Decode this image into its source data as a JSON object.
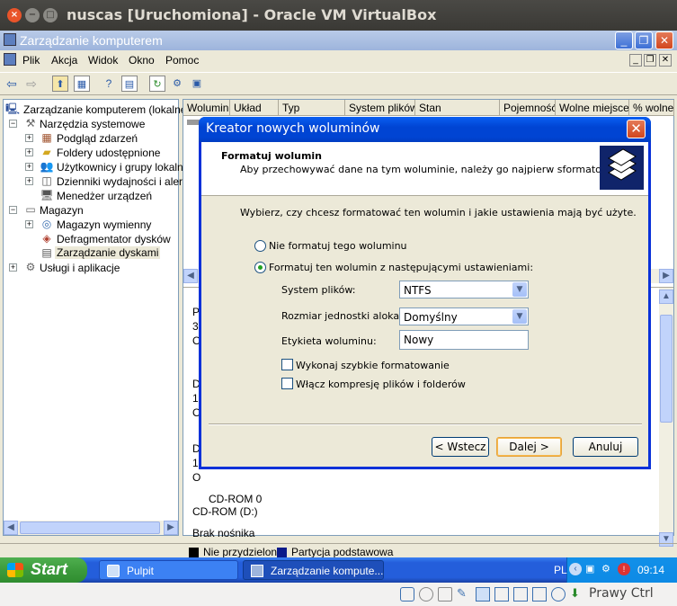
{
  "vbox": {
    "title": "nuscas [Uruchomiona] - Oracle VM VirtualBox",
    "host_key": "Prawy Ctrl"
  },
  "cm": {
    "title": "Zarządzanie komputerem",
    "menu": [
      "Plik",
      "Akcja",
      "Widok",
      "Okno",
      "Pomoc"
    ]
  },
  "tree": {
    "items": [
      "Zarządzanie komputerem (lokalne)",
      "Narzędzia systemowe",
      "Podgląd zdarzeń",
      "Foldery udostępnione",
      "Użytkownicy i grupy lokalne",
      "Dzienniki wydajności i alerty",
      "Menedżer urządzeń",
      "Magazyn",
      "Magazyn wymienny",
      "Defragmentator dysków",
      "Zarządzanie dyskami",
      "Usługi i aplikacje"
    ]
  },
  "volumes": {
    "columns": [
      "Wolumin",
      "Układ",
      "Typ",
      "System plików",
      "Stan",
      "Pojemność",
      "Wolne miejsce",
      "% wolneg"
    ]
  },
  "disks": {
    "cdrom_label": "CD-ROM 0",
    "cdrom_device": "CD-ROM (D:)",
    "cdrom_status": "Brak nośnika",
    "partial": [
      "D",
      "Pu",
      "3(",
      "O",
      "D",
      "1(",
      "O",
      "D",
      "1(",
      "O"
    ]
  },
  "legend": {
    "unallocated": "Nie przydzielone",
    "primary": "Partycja podstawowa"
  },
  "dialog": {
    "title": "Kreator nowych woluminów",
    "header_title": "Formatuj wolumin",
    "header_subtitle": "Aby przechowywać dane na tym woluminie, należy go najpierw sformatować.",
    "intro": "Wybierz, czy chcesz formatować ten wolumin i jakie ustawienia mają być użyte.",
    "radio_no_format": "Nie formatuj tego woluminu",
    "radio_format": "Formatuj ten wolumin z następującymi ustawieniami:",
    "fs_label": "System plików:",
    "fs_value": "NTFS",
    "alloc_label": "Rozmiar jednostki alokacji:",
    "alloc_value": "Domyślny",
    "vol_label": "Etykieta woluminu:",
    "vol_value": "Nowy",
    "quick_format": "Wykonaj szybkie formatowanie",
    "compression": "Włącz kompresję plików i folderów",
    "back": "< Wstecz",
    "next": "Dalej >",
    "cancel": "Anuluj"
  },
  "taskbar": {
    "start": "Start",
    "tasks": [
      "Pulpit",
      "Zarządzanie kompute..."
    ],
    "lang": "PL",
    "clock": "09:14"
  }
}
